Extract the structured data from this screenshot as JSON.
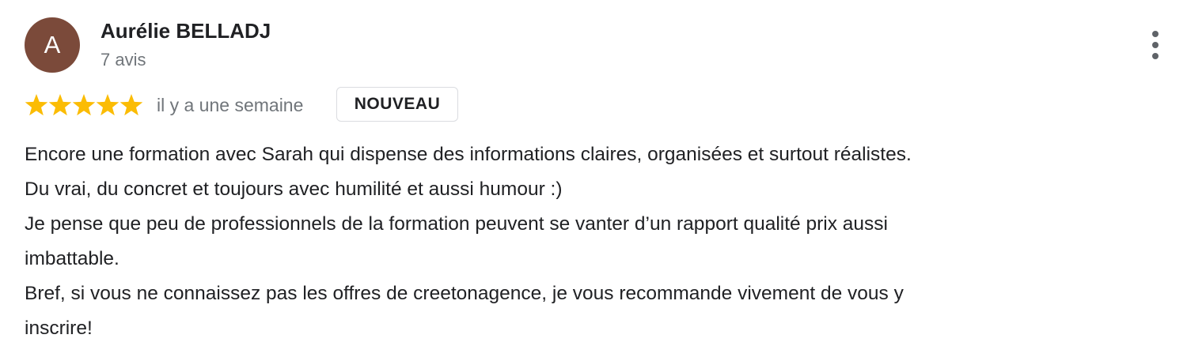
{
  "review": {
    "author": {
      "initial": "A",
      "name": "Aurélie BELLADJ",
      "reviews_count": "7 avis",
      "avatar_color": "#7b4a3a"
    },
    "menu_icon": "more-vert-icon",
    "rating": {
      "stars": 5,
      "max": 5,
      "star_color": "#fbbc04",
      "icon": "star-icon"
    },
    "date": "il y a une semaine",
    "badge": "NOUVEAU",
    "text_lines": [
      "Encore une formation avec Sarah qui dispense des informations claires, organisées et surtout réalistes.",
      "Du vrai, du concret et toujours avec humilité et aussi humour :)",
      "Je pense que peu de professionnels de la formation peuvent se vanter d’un rapport qualité prix aussi",
      "imbattable.",
      "Bref, si vous ne connaissez pas les offres de creetonagence, je vous recommande vivement de vous y",
      "inscrire!"
    ]
  }
}
